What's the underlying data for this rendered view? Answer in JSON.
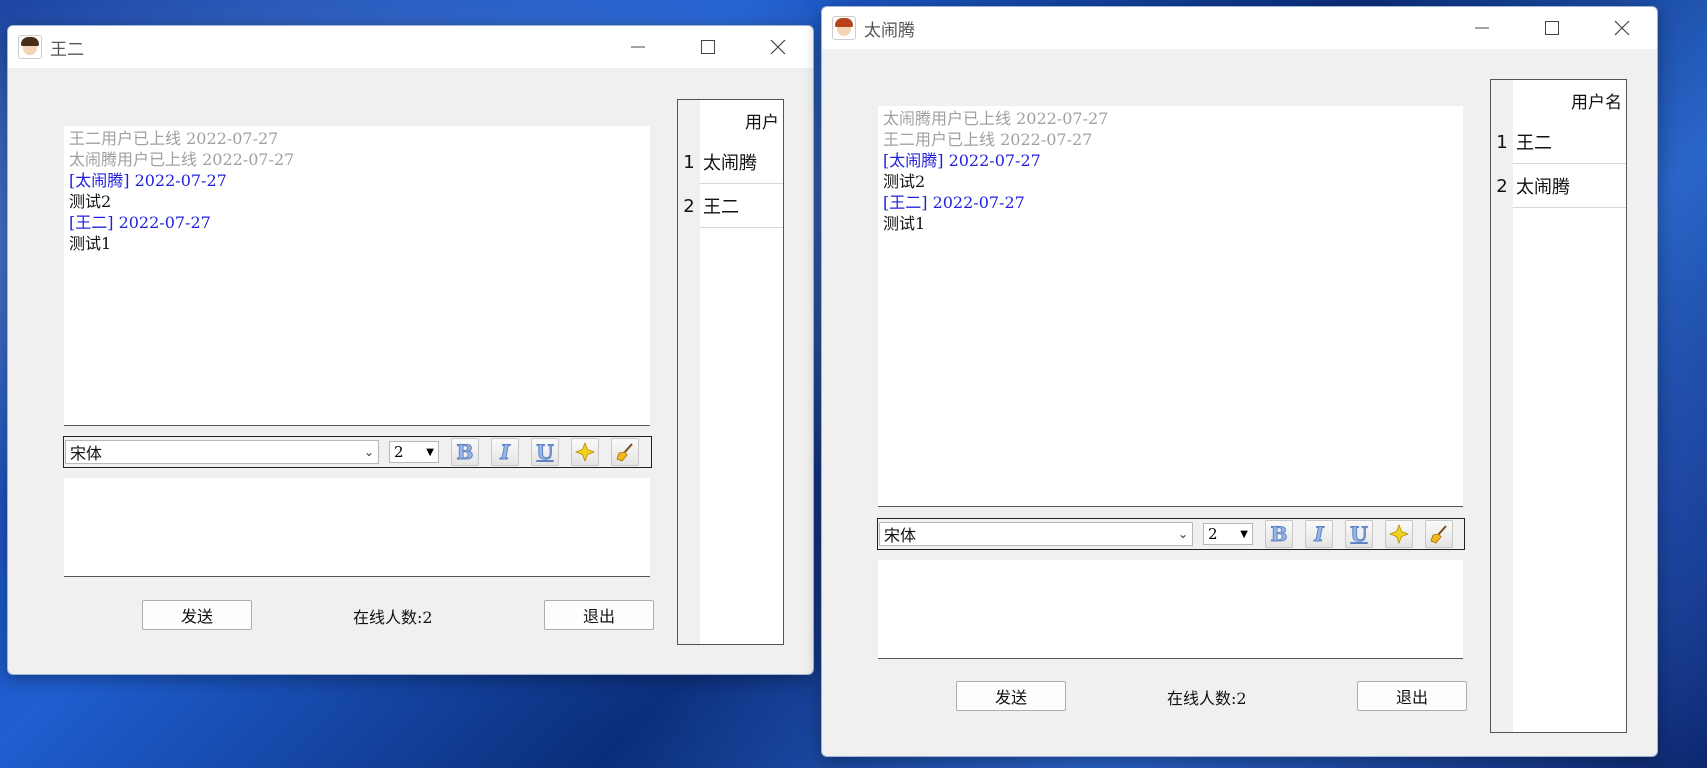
{
  "colors": {
    "system_msg": "#a0a0a0",
    "sender_header": "#2222dd",
    "window_bg": "#f0f0f0"
  },
  "windows": [
    {
      "title": "王二",
      "icon": "male-avatar-icon",
      "chat_lines": [
        {
          "kind": "sys",
          "text": "王二用户已上线 2022-07-27"
        },
        {
          "kind": "sys",
          "text": "太闹腾用户已上线 2022-07-27"
        },
        {
          "kind": "head",
          "text": "[太闹腾] 2022-07-27"
        },
        {
          "kind": "body",
          "text": "测试2"
        },
        {
          "kind": "head",
          "text": "[王二] 2022-07-27"
        },
        {
          "kind": "body",
          "text": "测试1"
        }
      ],
      "toolbar": {
        "font": "宋体",
        "size": "2"
      },
      "send_label": "发送",
      "online_text": "在线人数:2",
      "exit_label": "退出",
      "users_header": "用户",
      "users": [
        {
          "index": "1",
          "name": "太闹腾"
        },
        {
          "index": "2",
          "name": "王二"
        }
      ]
    },
    {
      "title": "太闹腾",
      "icon": "female-avatar-icon",
      "chat_lines": [
        {
          "kind": "sys",
          "text": "太闹腾用户已上线 2022-07-27"
        },
        {
          "kind": "sys",
          "text": "王二用户已上线 2022-07-27"
        },
        {
          "kind": "head",
          "text": "[太闹腾] 2022-07-27"
        },
        {
          "kind": "body",
          "text": "测试2"
        },
        {
          "kind": "head",
          "text": "[王二] 2022-07-27"
        },
        {
          "kind": "body",
          "text": "测试1"
        }
      ],
      "toolbar": {
        "font": "宋体",
        "size": "2"
      },
      "send_label": "发送",
      "online_text": "在线人数:2",
      "exit_label": "退出",
      "users_header": "用户名",
      "users": [
        {
          "index": "1",
          "name": "王二"
        },
        {
          "index": "2",
          "name": "太闹腾"
        }
      ]
    }
  ]
}
